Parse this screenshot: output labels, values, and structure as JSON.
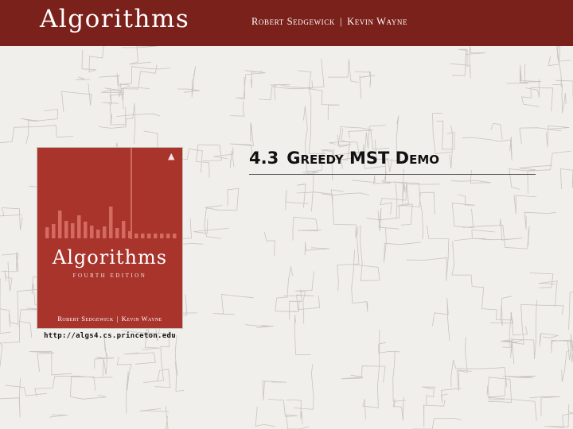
{
  "header": {
    "title": "Algorithms",
    "author1": "Robert Sedgewick",
    "author2": "Kevin Wayne",
    "separator": "|"
  },
  "cover": {
    "title": "Algorithms",
    "edition": "FOURTH EDITION",
    "author1": "Robert Sedgewick",
    "author2": "Kevin Wayne",
    "separator": "|",
    "url": "http://algs4.cs.princeton.edu"
  },
  "section": {
    "number": "4.3",
    "name": "Greedy MST Demo"
  },
  "colors": {
    "header_bg": "#7b211b",
    "cover_bg": "#a8342c",
    "page_bg": "#f1efec"
  }
}
